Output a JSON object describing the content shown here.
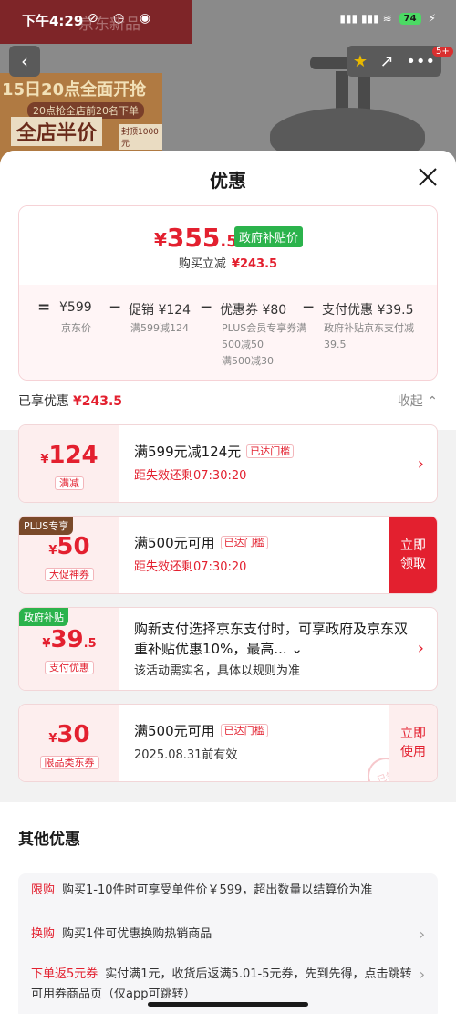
{
  "status_bar": {
    "time": "下午4:29",
    "icons": "⊘ ◷ ◉",
    "signal": "▮▮▮ ▮▮▮ ≋",
    "battery": "74",
    "charging": "⚡"
  },
  "background": {
    "brand": "京东新品",
    "banner_line1": "15日20点全面开抢",
    "banner_line2": "20点抢全店前20名下单",
    "banner_line3": "全店半价",
    "banner_line4": "封顶1000元",
    "notification_count": "5+",
    "back_icon": "‹",
    "actions": [
      "★",
      "↗",
      "•••"
    ]
  },
  "sheet": {
    "title": "优惠",
    "close_icon": "close-icon"
  },
  "price_summary": {
    "currency": "¥",
    "price_int": "355",
    "price_dec": ".5",
    "price_tag": "政府补贴价",
    "saved_label": "购买立减",
    "saved_value": "¥243.5",
    "formula": {
      "eq": "=",
      "minus": "−",
      "base_value": "¥599",
      "base_label": "京东价",
      "promo_value": "促销 ¥124",
      "promo_sub": "满599减124",
      "coupon_value": "优惠券 ¥80",
      "coupon_sub": "PLUS会员专享券满500减50",
      "coupon_sub2": "满500减30",
      "pay_value": "支付优惠 ¥39.5",
      "pay_sub": "政府补贴京东支付减39.5"
    }
  },
  "enjoyed": {
    "label": "已享优惠",
    "value": "¥243.5",
    "collapse": "收起 ⌃"
  },
  "coupons": [
    {
      "currency": "¥",
      "amount": "124",
      "decimal": "",
      "kind": "满减",
      "corner": "",
      "title": "满599元减124元",
      "tag": "已达门槛",
      "sub": "距失效还剩07:30:20",
      "action": "›"
    },
    {
      "currency": "¥",
      "amount": "50",
      "decimal": "",
      "kind": "大促神券",
      "corner": "PLUS专享",
      "title": "满500元可用",
      "tag": "已达门槛",
      "sub": "距失效还剩07:30:20",
      "action_line1": "立即",
      "action_line2": "领取"
    },
    {
      "currency": "¥",
      "amount": "39",
      "decimal": ".5",
      "kind": "支付优惠",
      "corner": "政府补贴",
      "title": "购新支付选择京东支付时，可享政府及京东双重补贴优惠10%，最高... ⌄",
      "sub": "该活动需实名，具体以规则为准",
      "action": "›"
    },
    {
      "currency": "¥",
      "amount": "30",
      "decimal": "",
      "kind": "限品类东券",
      "corner": "",
      "title": "满500元可用",
      "tag": "已达门槛",
      "sub": "2025.08.31前有效",
      "action_line1": "立即",
      "action_line2": "使用",
      "stamp": "已领"
    }
  ],
  "other": {
    "title": "其他优惠",
    "items": [
      {
        "kind": "限购",
        "text": "购买1-10件时可享受单件价￥599，超出数量以结算价为准"
      },
      {
        "kind": "换购",
        "text": "购买1件可优惠换购热销商品",
        "arrow": "›"
      },
      {
        "kind": "下单返5元券",
        "text": "实付满1元，收货后返满5.01-5元券，先到先得，点击跳转可用券商品页（仅app可跳转）",
        "arrow": "›"
      }
    ]
  },
  "colors": {
    "accent_red": "#e3202f",
    "gov_green": "#2bb34c",
    "plus_brown": "#7a4a2a"
  }
}
